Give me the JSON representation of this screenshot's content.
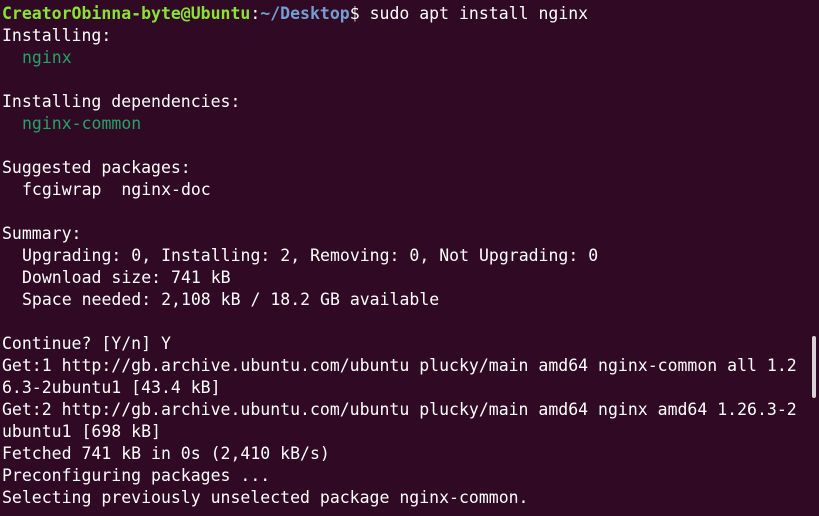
{
  "prompt": {
    "user_host": "CreatorObinna-byte@Ubuntu",
    "colon": ":",
    "path": "~/Desktop",
    "dollar": "$",
    "command": " sudo apt install nginx"
  },
  "output": [
    {
      "text": "Installing:",
      "style": "white",
      "indent": false
    },
    {
      "text": "nginx",
      "style": "green",
      "indent": true
    },
    {
      "text": "",
      "style": "white",
      "indent": false
    },
    {
      "text": "Installing dependencies:",
      "style": "white",
      "indent": false
    },
    {
      "text": "nginx-common",
      "style": "green",
      "indent": true
    },
    {
      "text": "",
      "style": "white",
      "indent": false
    },
    {
      "text": "Suggested packages:",
      "style": "white",
      "indent": false
    },
    {
      "text": "fcgiwrap  nginx-doc",
      "style": "white",
      "indent": true
    },
    {
      "text": "",
      "style": "white",
      "indent": false
    },
    {
      "text": "Summary:",
      "style": "white",
      "indent": false
    },
    {
      "text": "Upgrading: 0, Installing: 2, Removing: 0, Not Upgrading: 0",
      "style": "white",
      "indent": true
    },
    {
      "text": "Download size: 741 kB",
      "style": "white",
      "indent": true
    },
    {
      "text": "Space needed: 2,108 kB / 18.2 GB available",
      "style": "white",
      "indent": true
    },
    {
      "text": "",
      "style": "white",
      "indent": false
    },
    {
      "text": "Continue? [Y/n] Y",
      "style": "white",
      "indent": false
    },
    {
      "text": "Get:1 http://gb.archive.ubuntu.com/ubuntu plucky/main amd64 nginx-common all 1.2",
      "style": "white",
      "indent": false
    },
    {
      "text": "6.3-2ubuntu1 [43.4 kB]",
      "style": "white",
      "indent": false
    },
    {
      "text": "Get:2 http://gb.archive.ubuntu.com/ubuntu plucky/main amd64 nginx amd64 1.26.3-2",
      "style": "white",
      "indent": false
    },
    {
      "text": "ubuntu1 [698 kB]",
      "style": "white",
      "indent": false
    },
    {
      "text": "Fetched 741 kB in 0s (2,410 kB/s)",
      "style": "white",
      "indent": false
    },
    {
      "text": "Preconfiguring packages ...",
      "style": "white",
      "indent": false
    },
    {
      "text": "Selecting previously unselected package nginx-common.",
      "style": "white",
      "indent": false
    }
  ],
  "colors": {
    "background": "#300a24",
    "user_host": "#8ae234",
    "path": "#729fcf",
    "package": "#26a269",
    "text": "#ffffff"
  }
}
